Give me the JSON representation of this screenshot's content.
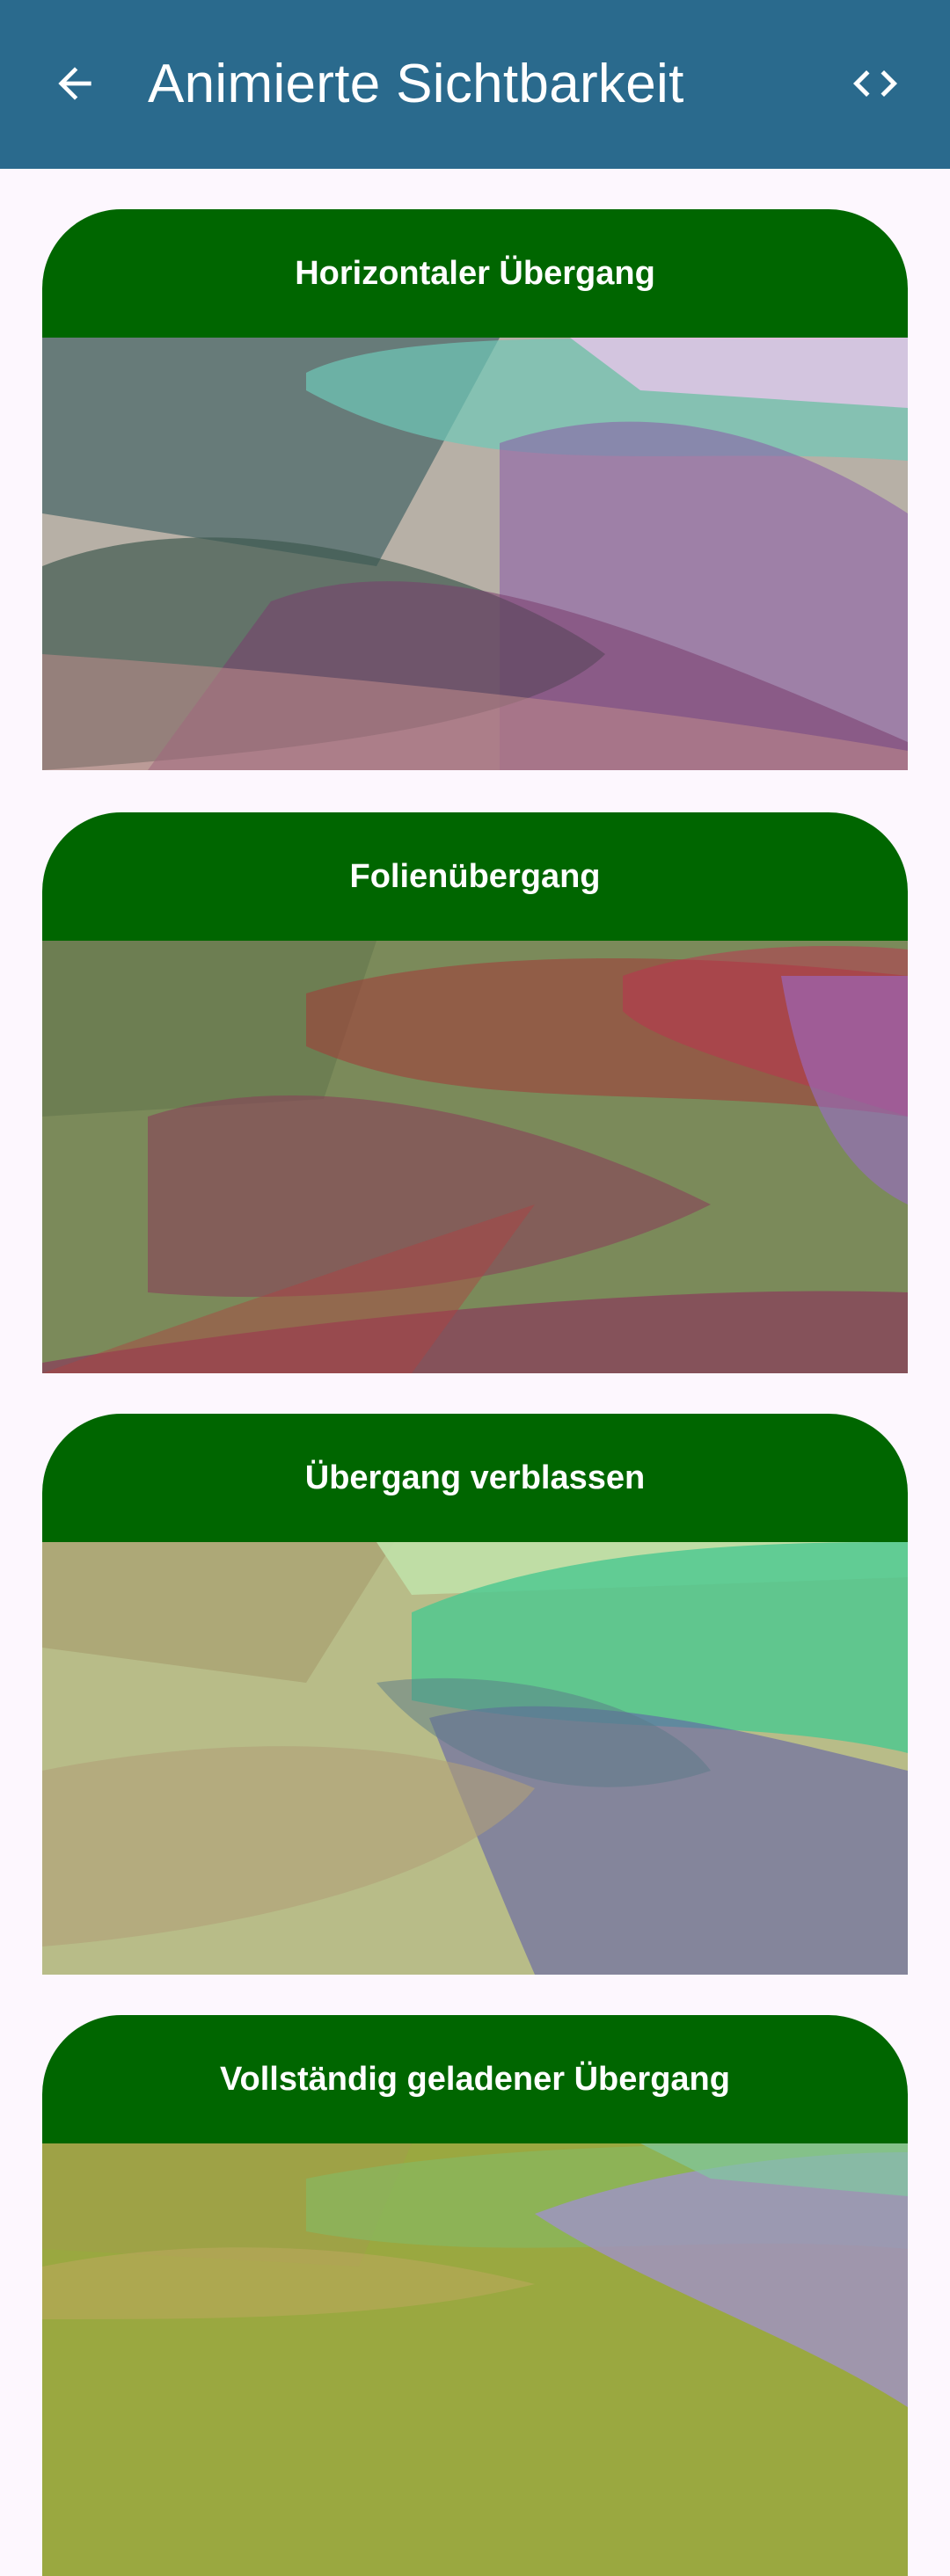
{
  "app_bar": {
    "title": "Animierte Sichtbarkeit",
    "back_icon": "arrow-back-icon",
    "code_icon": "code-icon",
    "background": "#2a6a8d"
  },
  "header_color": "#006600",
  "cards": [
    {
      "title": "Horizontaler Übergang",
      "image": "abstract-shapes-image",
      "palette": [
        "#b7b0a6",
        "#4c6a6a",
        "#7a3d6e",
        "#c08a8a",
        "#8a5aa8",
        "#6fc9b8"
      ]
    },
    {
      "title": "Folienübergang",
      "image": "abstract-shapes-image",
      "palette": [
        "#7b8a5a",
        "#6a7a50",
        "#a0403a",
        "#8a3a5a",
        "#9a6ac8",
        "#c03050"
      ]
    },
    {
      "title": "Übergang verblassen",
      "image": "abstract-shapes-image",
      "palette": [
        "#b8bc88",
        "#a8a070",
        "#4ac890",
        "#6060a8",
        "#5a7a88",
        "#c0e0a8"
      ]
    },
    {
      "title": "Vollständig geladener Übergang",
      "image": "abstract-shapes-image",
      "palette": [
        "#9aa840",
        "#88b860",
        "#a090d0",
        "#c0a860",
        "#80c8a0",
        "#b0c080"
      ]
    }
  ]
}
